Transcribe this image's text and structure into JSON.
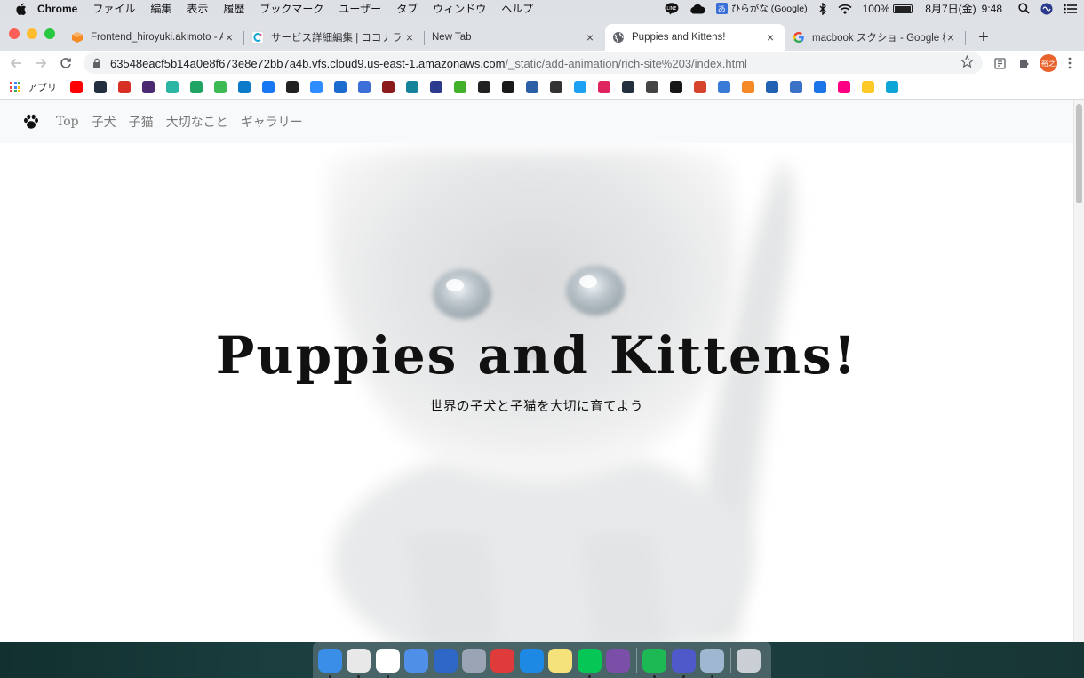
{
  "menubar": {
    "app_name": "Chrome",
    "menus": [
      "ファイル",
      "編集",
      "表示",
      "履歴",
      "ブックマーク",
      "ユーザー",
      "タブ",
      "ウィンドウ",
      "ヘルプ"
    ],
    "ime_glyph": "あ",
    "ime_label": "ひらがな (Google)",
    "battery": "100%",
    "date": "8月7日(金)",
    "time": "9:48"
  },
  "tabs": [
    {
      "title": "Frontend_hiroyuki.akimoto - AW",
      "favicon": "aws-cloud9-icon",
      "color": "#f58a25"
    },
    {
      "title": "サービス詳細編集 | ココナラ",
      "favicon": "coconala-icon",
      "color": "#0da5d6"
    },
    {
      "title": "New Tab",
      "favicon": "",
      "color": ""
    },
    {
      "title": "Puppies and Kittens!",
      "favicon": "globe-icon",
      "color": "#5f6368"
    },
    {
      "title": "macbook スクショ - Google 検索",
      "favicon": "google-icon",
      "color": "#4285f4"
    }
  ],
  "active_tab": 3,
  "omnibox": {
    "host": "63548eacf5b14a0e8f673e8e72bb7a4b.vfs.cloud9.us-east-1.amazonaws.com",
    "path": "/_static/add-animation/rich-site%203/index.html"
  },
  "profile_avatar_text": "裕之",
  "bookmarks": {
    "apps_label": "アプリ",
    "icons": [
      {
        "name": "youtube",
        "color": "#ff0000"
      },
      {
        "name": "amazon",
        "color": "#232f3e"
      },
      {
        "name": "gmail",
        "color": "#d93025"
      },
      {
        "name": "bookmark-p",
        "color": "#4b2a72"
      },
      {
        "name": "bookmark-teal",
        "color": "#2ab5a5"
      },
      {
        "name": "google-drive",
        "color": "#1fa463"
      },
      {
        "name": "bookmark-green",
        "color": "#3cba54"
      },
      {
        "name": "crowdworks",
        "color": "#0b7ac9"
      },
      {
        "name": "facebook",
        "color": "#1877f2"
      },
      {
        "name": "bookmark-g",
        "color": "#222222"
      },
      {
        "name": "zoom",
        "color": "#2d8cff"
      },
      {
        "name": "bookmark-m",
        "color": "#1c6cd0"
      },
      {
        "name": "bookmark-calendar",
        "color": "#3d6fd8"
      },
      {
        "name": "bookmark-red",
        "color": "#8b1a1a"
      },
      {
        "name": "bookmark-teal-2",
        "color": "#17839a"
      },
      {
        "name": "bookmark-globe",
        "color": "#2b3a8c"
      },
      {
        "name": "bookmark-px",
        "color": "#43b02a"
      },
      {
        "name": "bookmark-w",
        "color": "#222222"
      },
      {
        "name": "bookmark-square",
        "color": "#1a1a1a"
      },
      {
        "name": "bookmark-kanji",
        "color": "#2b5fa8"
      },
      {
        "name": "bookmark-pattern",
        "color": "#333333"
      },
      {
        "name": "twitter",
        "color": "#1da1f2"
      },
      {
        "name": "bookmark-pink",
        "color": "#e0245e"
      },
      {
        "name": "amazon-2",
        "color": "#232f3e"
      },
      {
        "name": "bookmark-fox",
        "color": "#444444"
      },
      {
        "name": "github",
        "color": "#181717"
      },
      {
        "name": "bookmark-red-2",
        "color": "#d6442b"
      },
      {
        "name": "bookmark-c",
        "color": "#3b7bd8"
      },
      {
        "name": "bookmark-orange",
        "color": "#f58a25"
      },
      {
        "name": "bookmark-blue-2",
        "color": "#2162b3"
      },
      {
        "name": "bookmark-code",
        "color": "#3a72c8"
      },
      {
        "name": "bookmark-flag",
        "color": "#1b74e8"
      },
      {
        "name": "flickr",
        "color": "#ff0084"
      },
      {
        "name": "firebase",
        "color": "#ffca28"
      },
      {
        "name": "coconala",
        "color": "#0da5d6"
      }
    ]
  },
  "site": {
    "nav": [
      "Top",
      "子犬",
      "子猫",
      "大切なこと",
      "ギャラリー"
    ],
    "hero_title": "Puppies and Kittens!",
    "hero_subtitle": "世界の子犬と子猫を大切に育てよう"
  },
  "dock": {
    "icons": [
      {
        "name": "finder",
        "color": "#3b8ee8",
        "running": true
      },
      {
        "name": "chrome",
        "color": "#e8e8e8",
        "running": true
      },
      {
        "name": "slack",
        "color": "#ffffff",
        "running": true
      },
      {
        "name": "mail-app",
        "color": "#4f8fe8",
        "running": false
      },
      {
        "name": "sourcetree",
        "color": "#2f67c7",
        "running": false
      },
      {
        "name": "launchpad",
        "color": "#9aa4b4",
        "running": false
      },
      {
        "name": "xmind",
        "color": "#e03b3b",
        "running": false
      },
      {
        "name": "vscode",
        "color": "#1e88e5",
        "running": false
      },
      {
        "name": "notes",
        "color": "#f6e27a",
        "running": false
      },
      {
        "name": "line",
        "color": "#06c755",
        "running": true
      },
      {
        "name": "github-desktop",
        "color": "#7b4ea8",
        "running": false
      },
      {
        "name": "spotify",
        "color": "#1db954",
        "running": true
      },
      {
        "name": "teams",
        "color": "#5059c9",
        "running": true
      },
      {
        "name": "preview",
        "color": "#9fb7d0",
        "running": true
      },
      {
        "name": "trash",
        "color": "#c9cfd4",
        "running": false
      }
    ]
  }
}
